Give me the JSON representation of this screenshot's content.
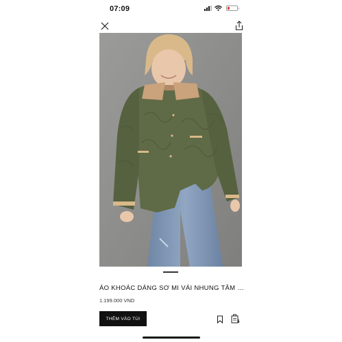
{
  "status_bar": {
    "time": "07:09",
    "battery_level": 0.2,
    "battery_color": "#e53935"
  },
  "top_bar": {
    "close_icon": "close-icon",
    "share_icon": "share-icon"
  },
  "product": {
    "title": "ÁO KHOÁC DÁNG SƠ MI VẢI NHUNG TĂM CHẦN B...",
    "price": "1.199.000 VND",
    "add_to_bag_label": "THÊM VÀO TÚI",
    "bookmark_icon": "bookmark-icon",
    "size_guide_icon": "size-guide-icon"
  },
  "colors": {
    "accent": "#111111",
    "jacket": "#5f6a46",
    "jeans": "#7d93b2",
    "background_photo": "#8e8e8c"
  }
}
